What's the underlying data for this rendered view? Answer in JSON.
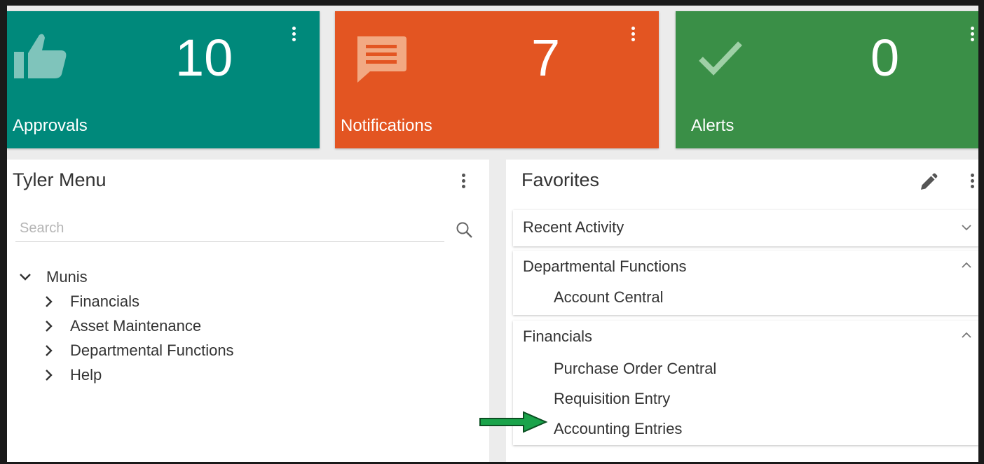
{
  "colors": {
    "approvals_bg": "#00897b",
    "notifications_bg": "#e35522",
    "alerts_bg": "#3a8f47",
    "arrow": "#1aa34a"
  },
  "tiles": {
    "approvals": {
      "count": "10",
      "label": "Approvals",
      "icon": "thumbs-up-icon"
    },
    "notifications": {
      "count": "7",
      "label": "Notifications",
      "icon": "message-icon"
    },
    "alerts": {
      "count": "0",
      "label": "Alerts",
      "icon": "check-icon"
    }
  },
  "tyler_menu": {
    "title": "Tyler Menu",
    "search_placeholder": "Search",
    "tree": {
      "root": "Munis",
      "children": [
        "Financials",
        "Asset Maintenance",
        "Departmental Functions",
        "Help"
      ]
    }
  },
  "favorites": {
    "title": "Favorites",
    "groups": [
      {
        "title": "Recent Activity",
        "expanded": false,
        "items": []
      },
      {
        "title": "Departmental Functions",
        "expanded": true,
        "items": [
          "Account Central"
        ]
      },
      {
        "title": "Financials",
        "expanded": true,
        "items": [
          "Purchase Order Central",
          "Requisition Entry",
          "Accounting Entries"
        ]
      }
    ]
  }
}
